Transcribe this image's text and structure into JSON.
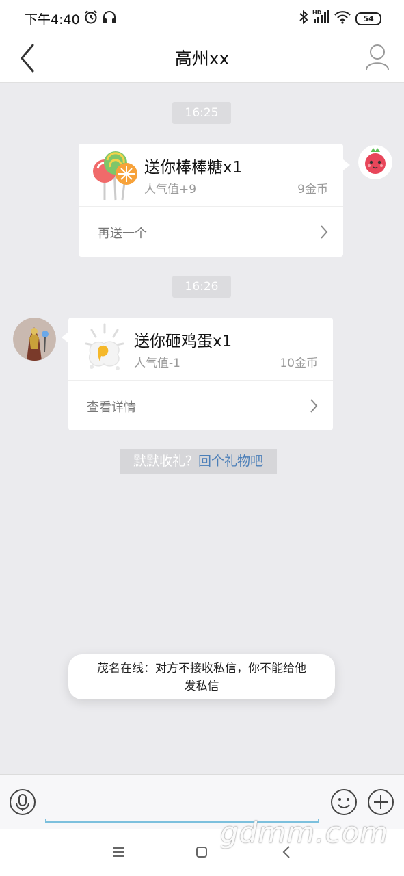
{
  "status_bar": {
    "time": "下午4:40",
    "battery": "54",
    "hd": "HD"
  },
  "header": {
    "title": "高州xx"
  },
  "messages": [
    {
      "time": "16:25",
      "gift_title": "送你棒棒糖x1",
      "popularity": "人气值+9",
      "coins": "9金币",
      "action": "再送一个"
    },
    {
      "time": "16:26",
      "gift_title": "送你砸鸡蛋x1",
      "popularity": "人气值-1",
      "coins": "10金币",
      "action": "查看详情"
    }
  ],
  "notice": {
    "text": "默默收礼？",
    "link": "回个礼物吧"
  },
  "toast": {
    "line1": "茂名在线：对方不接收私信，你不能给他",
    "line2": "发私信"
  },
  "watermark": "gdmm.com"
}
